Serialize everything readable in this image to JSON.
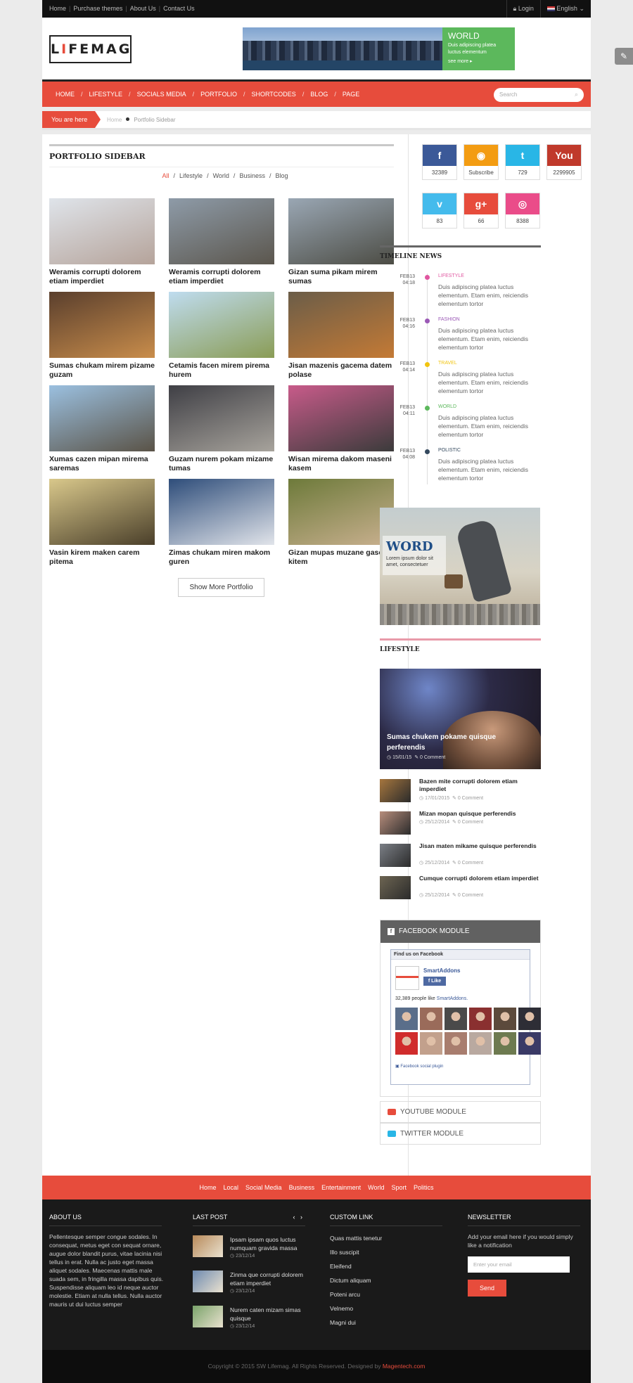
{
  "topbar": {
    "links": [
      "Home",
      "Purchase themes",
      "About Us",
      "Contact Us"
    ],
    "login": "Login",
    "language": "English"
  },
  "header": {
    "logo_l": "L",
    "logo_i": "I",
    "logo_rest": "FEMAG",
    "banner": {
      "title": "WORLD",
      "text": "Duis adipiscing platea luctus elementum",
      "more": "see more"
    }
  },
  "nav": {
    "items": [
      "HOME",
      "LIFESTYLE",
      "SOCIALS MEDIA",
      "PORTFOLIO",
      "SHORTCODES",
      "BLOG",
      "PAGE"
    ],
    "active": "PORTFOLIO",
    "search_placeholder": "Search"
  },
  "breadcrumb": {
    "label": "You are here",
    "home": "Home",
    "current": "Portfolio Sidebar"
  },
  "portfolio": {
    "title": "PORTFOLIO SIDEBAR",
    "filters": [
      "All",
      "Lifestyle",
      "World",
      "Business",
      "Blog"
    ],
    "items": [
      {
        "caption": "Weramis corrupti dolorem etiam imperdiet",
        "colors": [
          "#dfe4ea",
          "#b5a39a"
        ]
      },
      {
        "caption": "Weramis corrupti dolorem etiam imperdiet",
        "colors": [
          "#8e9ba8",
          "#5b564d"
        ]
      },
      {
        "caption": "Gizan suma pikam mirem sumas",
        "colors": [
          "#9aa7b4",
          "#4c4c44"
        ]
      },
      {
        "caption": "Sumas chukam mirem pizame guzam",
        "colors": [
          "#5a3f2d",
          "#c98d4b"
        ]
      },
      {
        "caption": "Cetamis facen mirem pirema hurem",
        "colors": [
          "#bfdcef",
          "#8a9c55"
        ]
      },
      {
        "caption": "Jisan mazenis gacema datem polase",
        "colors": [
          "#6b5d48",
          "#c47a35"
        ]
      },
      {
        "caption": "Xumas cazen mipan mirema saremas",
        "colors": [
          "#9bc0e0",
          "#5a5347"
        ]
      },
      {
        "caption": "Guzam nurem pokam mizame tumas",
        "colors": [
          "#3f3f45",
          "#a7a39c"
        ]
      },
      {
        "caption": "Wisan mirema dakom maseni kasem",
        "colors": [
          "#c85b8a",
          "#3b3b3b"
        ]
      },
      {
        "caption": "Vasin kirem maken carem pitema",
        "colors": [
          "#d9c88b",
          "#4a3f2a"
        ]
      },
      {
        "caption": "Zimas chukam miren makom guren",
        "colors": [
          "#2e4d7a",
          "#e1e4ea"
        ]
      },
      {
        "caption": "Gizan mupas muzane gasen kitem",
        "colors": [
          "#6d7a3a",
          "#c9b08f"
        ]
      }
    ],
    "more": "Show More Portfolio"
  },
  "social": [
    {
      "name": "facebook-icon",
      "glyph": "f",
      "count": "32389",
      "color": "#3b5998"
    },
    {
      "name": "rss-icon",
      "glyph": "◉",
      "count": "Subscribe",
      "color": "#f39c12"
    },
    {
      "name": "twitter-icon",
      "glyph": "t",
      "count": "729",
      "color": "#29b6e6"
    },
    {
      "name": "youtube-icon",
      "glyph": "You",
      "count": "2299905",
      "color": "#c0392b"
    },
    {
      "name": "vimeo-icon",
      "glyph": "v",
      "count": "83",
      "color": "#44bbec"
    },
    {
      "name": "googleplus-icon",
      "glyph": "g+",
      "count": "66",
      "color": "#e74c3c"
    },
    {
      "name": "dribbble-icon",
      "glyph": "◎",
      "count": "8388",
      "color": "#ea4c89"
    }
  ],
  "timeline": {
    "title": "TIMELINE NEWS",
    "items": [
      {
        "date": "FEB13",
        "time": "04:18",
        "category": "LIFESTYLE",
        "color": "#e056a0",
        "text": "Duis adipiscing platea luctus elementum. Etam enim, reiciendis elementum tortor"
      },
      {
        "date": "FEB13",
        "time": "04:16",
        "category": "FASHION",
        "color": "#9b59b6",
        "text": "Duis adipiscing platea luctus elementum. Etam enim, reiciendis elementum tortor"
      },
      {
        "date": "FEB13",
        "time": "04:14",
        "category": "TRAVEL",
        "color": "#f1c40f",
        "text": "Duis adipiscing platea luctus elementum. Etam enim, reiciendis elementum tortor"
      },
      {
        "date": "FEB13",
        "time": "04:11",
        "category": "WORLD",
        "color": "#5cb85c",
        "text": "Duis adipiscing platea luctus elementum. Etam enim, reiciendis elementum tortor"
      },
      {
        "date": "FEB13",
        "time": "04:08",
        "category": "POLISTIC",
        "color": "#34495e",
        "text": "Duis adipiscing platea luctus elementum. Etam enim, reiciendis elementum tortor"
      }
    ]
  },
  "ad": {
    "title": "WORD",
    "text": "Lorem ipsum dolor sit amet, consectetuer"
  },
  "lifestyle": {
    "title": "LIFESTYLE",
    "featured": {
      "title": "Sumas chukem pokame quisque perferendis",
      "date": "15/01/15",
      "comments": "0 Comment"
    },
    "items": [
      {
        "title": "Bazen mite corrupti dolorem etiam imperdiet",
        "date": "17/01/2015",
        "comments": "0 Comment",
        "color": "#a6763e"
      },
      {
        "title": "Mizan mopan quisque perferendis",
        "date": "25/12/2014",
        "comments": "0 Comment",
        "color": "#b78d7c"
      },
      {
        "title": "Jisan maten mikame quisque perferendis",
        "date": "25/12/2014",
        "comments": "0 Comment",
        "color": "#7b7f86"
      },
      {
        "title": "Cumque corrupti dolorem etiam imperdiet",
        "date": "25/12/2014",
        "comments": "0 Comment",
        "color": "#6d6552"
      }
    ]
  },
  "facebook": {
    "title": "FACEBOOK MODULE",
    "find": "Find us on Facebook",
    "page": "SmartAddons",
    "like": "Like",
    "count_text": "32,389 people like",
    "count_page": "SmartAddons.",
    "plugin": "Facebook social plugin"
  },
  "modules": {
    "youtube": "YOUTUBE MODULE",
    "twitter": "TWITTER MODULE"
  },
  "footer_nav": [
    "Home",
    "Local",
    "Social Media",
    "Business",
    "Entertainment",
    "World",
    "Sport",
    "Politics"
  ],
  "footer": {
    "about": {
      "title": "ABOUT US",
      "text": "Pellentesque semper congue sodales. In consequat, metus eget con sequat ornare, augue dolor blandit purus, vitae lacinia nisi tellus in erat. Nulla ac justo eget massa aliquet sodales. Maecenas mattis male suada sem, in fringilla massa dapibus quis. Suspendisse aliquam leo id neque auctor molestie. Etiam at nulla tellus. Nulla auctor mauris ut dui luctus semper"
    },
    "last_post": {
      "title": "LAST POST",
      "items": [
        {
          "title": "Ipsam ipsam quos luctus numquam gravida massa",
          "date": "23/12/14",
          "color": "#b88a5a"
        },
        {
          "title": "Zinma que corrupti dolorem etiam imperdiet",
          "date": "23/12/14",
          "color": "#6e8ab0"
        },
        {
          "title": "Nurem caten mizam simas quisque",
          "date": "23/12/14",
          "color": "#7aa36a"
        }
      ]
    },
    "custom": {
      "title": "CUSTOM LINK",
      "links": [
        "Quas mattis tenetur",
        "Illo suscipit",
        "Eleifend",
        "Dictum aliquam",
        "Poteni arcu",
        "Velnemo",
        "Magni dui"
      ]
    },
    "newsletter": {
      "title": "NEWSLETTER",
      "text": "Add your email here if you would simply like a notification",
      "placeholder": "Enter your email",
      "button": "Send"
    }
  },
  "copyright": {
    "text": "Copyright © 2015 SW Lifemag. All Rights Reserved. Designed by",
    "link": "Magentech.com"
  }
}
